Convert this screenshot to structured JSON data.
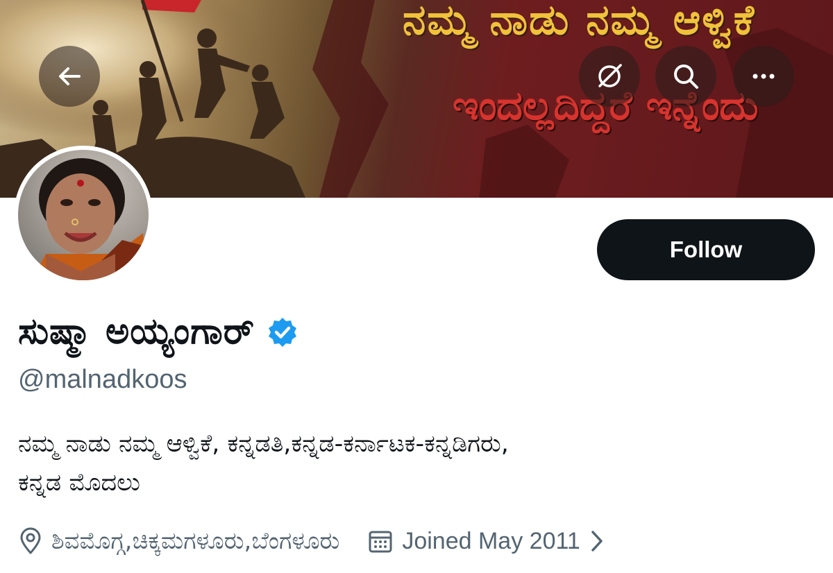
{
  "header": {
    "banner_line1": "ನಮ್ಮ ನಾಡು ನಮ್ಮ ಆಳ್ವಿಕೆ",
    "banner_line2": "ಇಂದಲ್ಲದಿದ್ದರೆ ಇನ್ನೆಂದು",
    "back_icon": "arrow-left-icon",
    "grok_icon": "grok-icon",
    "search_icon": "search-icon",
    "more_icon": "more-horizontal-icon"
  },
  "profile": {
    "display_name": "ಸುಷ್ಮಾ ಅಯ್ಯಂಗಾರ್",
    "handle": "@malnadkoos",
    "verified": true,
    "bio_line1": "ನಮ್ಮ ನಾಡು ನಮ್ಮ ಆಳ್ವಿಕೆ, ಕನ್ನಡತಿ,ಕನ್ನಡ-ಕರ್ನಾಟಕ-ಕನ್ನಡಿಗರು,",
    "bio_line2": "ಕನ್ನಡ ಮೊದಲು",
    "location": "ಶಿವಮೊಗ್ಗ,ಚಿಕ್ಕಮಗಳೂರು,ಬೆಂಗಳೂರು",
    "joined": "Joined May 2011"
  },
  "actions": {
    "follow_label": "Follow"
  },
  "colors": {
    "follow_bg": "#0f1419",
    "verified_blue": "#1d9bf0",
    "secondary_text": "#536471"
  }
}
